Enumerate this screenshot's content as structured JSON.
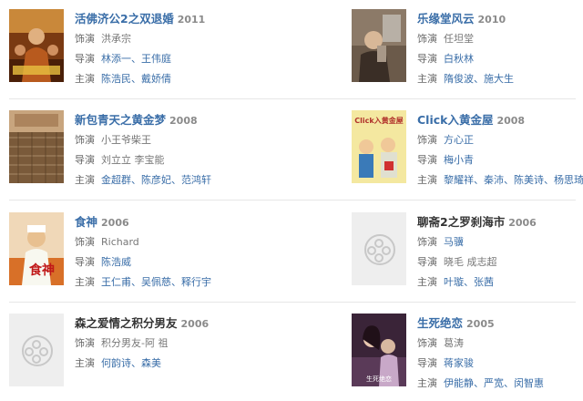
{
  "movies": [
    {
      "title": "活佛济公2之双退婚",
      "year": "2011",
      "role_label": "饰演",
      "role": "洪承宗",
      "director_label": "导演",
      "director": "林添一、王伟庭",
      "cast_label": "主演",
      "cast": "陈浩民、戴娇倩"
    },
    {
      "title": "乐缘堂风云",
      "year": "2010",
      "role_label": "饰演",
      "role": "任坦堂",
      "director_label": "导演",
      "director": "白秋林",
      "cast_label": "主演",
      "cast": "隋俊波、施大生"
    },
    {
      "title": "新包青天之黄金梦",
      "year": "2008",
      "role_label": "饰演",
      "role": "小王爷柴王",
      "director_label": "导演",
      "director": "刘立立 李宝能",
      "cast_label": "主演",
      "cast": "金超群、陈彦妃、范鸿轩"
    },
    {
      "title": "Click入黄金屋",
      "year": "2008",
      "role_label": "饰演",
      "role": "方心正",
      "director_label": "导演",
      "director": "梅小青",
      "cast_label": "主演",
      "cast": "黎耀祥、秦沛、陈美诗、杨思琦"
    },
    {
      "title": "食神",
      "year": "2006",
      "role_label": "饰演",
      "role": "Richard",
      "director_label": "导演",
      "director": "陈浩威",
      "cast_label": "主演",
      "cast": "王仁甫、吴佩慈、释行宇"
    },
    {
      "title": "聊斋2之罗刹海市",
      "year": "2006",
      "role_label": "饰演",
      "role": "马骥",
      "director_label": "导演",
      "director": "晓毛 成志超",
      "cast_label": "主演",
      "cast": "叶璇、张茜"
    },
    {
      "title": "森之爱情之积分男友",
      "year": "2006",
      "role_label": "饰演",
      "role": "积分男友-阿 祖",
      "director_label": "导演",
      "director": "",
      "cast_label": "主演",
      "cast": "何韵诗、森美"
    },
    {
      "title": "生死绝恋",
      "year": "2005",
      "role_label": "饰演",
      "role": "葛涛",
      "director_label": "导演",
      "director": "蒋家骏",
      "cast_label": "主演",
      "cast": "伊能静、严宽、闵智惠"
    }
  ],
  "poster_text": [
    "Click入黄金屋",
    "生死绝恋",
    "食神"
  ],
  "colors": {
    "title_blue": "#3a6ea8",
    "year_gray": "#8a8a8a",
    "label_gray": "#666666"
  }
}
